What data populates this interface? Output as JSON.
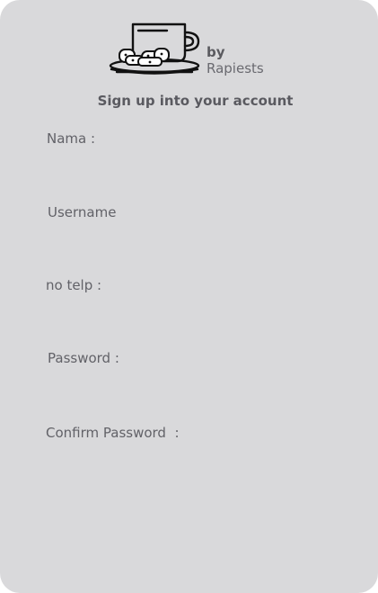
{
  "brand": {
    "by": "by",
    "name": "Rapiests",
    "logo_icon": "coffee-cup-with-cookies-icon"
  },
  "form": {
    "title": "Sign up into your account",
    "fields": [
      {
        "label": "Nama :",
        "value": ""
      },
      {
        "label": "Username",
        "value": ""
      },
      {
        "label": "no telp :",
        "value": ""
      },
      {
        "label": "Password :",
        "value": ""
      },
      {
        "label": "Confirm Password  :",
        "value": ""
      }
    ]
  },
  "colors": {
    "card_background": "#d9d9db",
    "text": "#626268",
    "icon_stroke": "#111111"
  }
}
